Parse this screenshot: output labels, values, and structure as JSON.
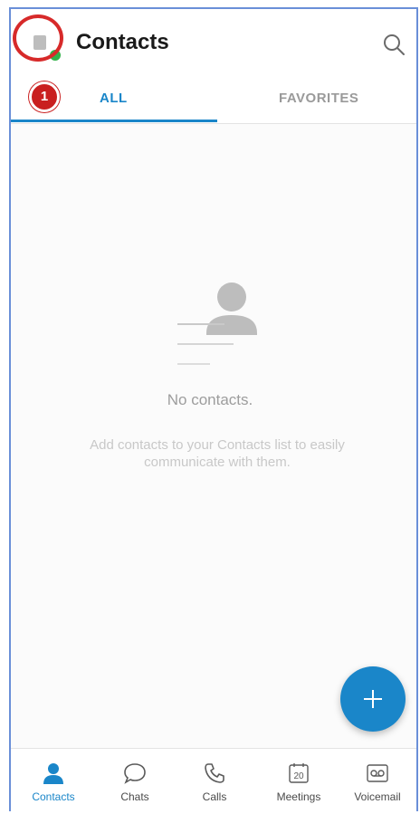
{
  "header": {
    "title": "Contacts",
    "avatar_status": "online",
    "annotation_number": "1"
  },
  "tabs": [
    {
      "label": "ALL",
      "active": true
    },
    {
      "label": "FAVORITES",
      "active": false
    }
  ],
  "empty_state": {
    "title": "No contacts.",
    "description": "Add contacts to your Contacts list to easily communicate with them."
  },
  "fab": {
    "icon": "plus-icon"
  },
  "bottom_nav": [
    {
      "label": "Contacts",
      "icon": "person-icon",
      "active": true
    },
    {
      "label": "Chats",
      "icon": "chat-bubble-icon",
      "active": false
    },
    {
      "label": "Calls",
      "icon": "phone-icon",
      "active": false
    },
    {
      "label": "Meetings",
      "icon": "calendar-icon",
      "badge": "20",
      "active": false
    },
    {
      "label": "Voicemail",
      "icon": "voicemail-icon",
      "active": false
    }
  ],
  "colors": {
    "accent": "#1a86c9",
    "status_online": "#32b24a",
    "annotation": "#d72a2a"
  }
}
